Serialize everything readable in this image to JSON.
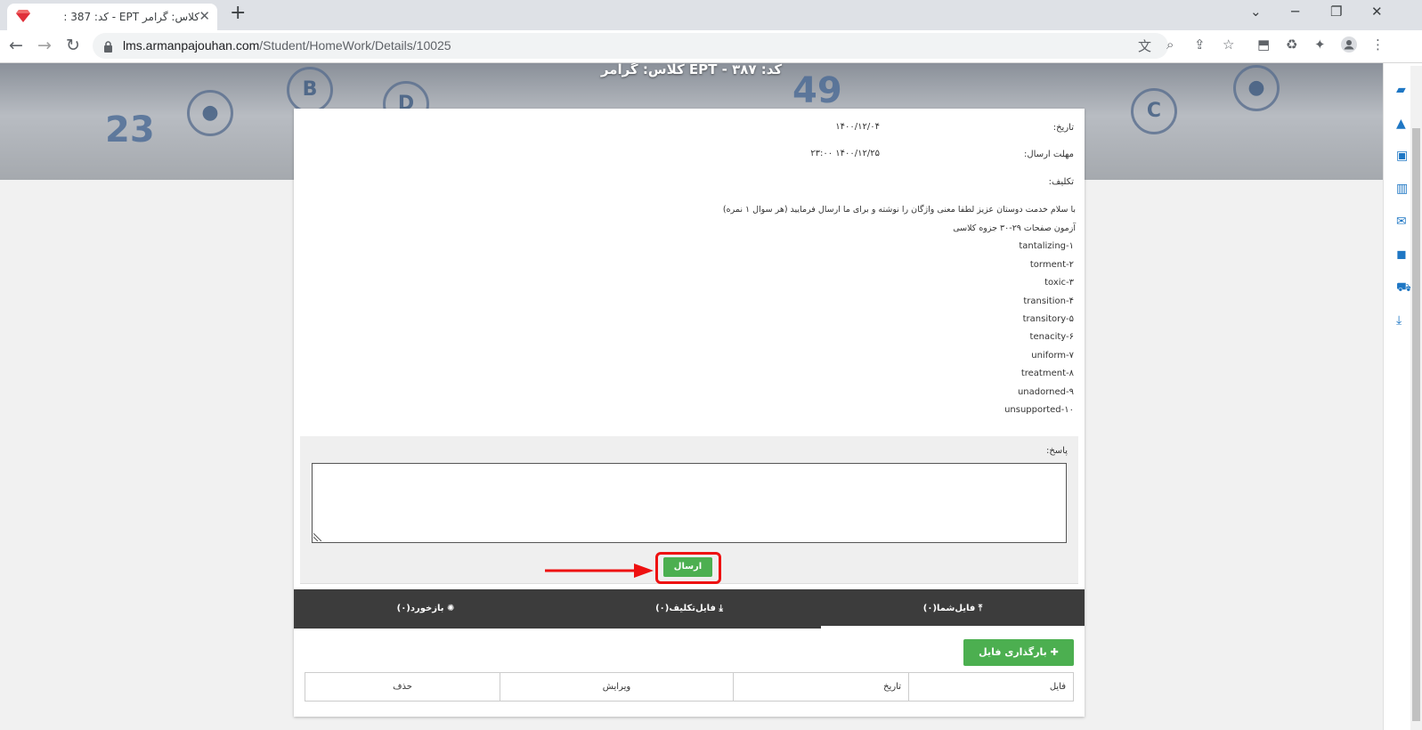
{
  "browser": {
    "tab_title": "کلاس: گرامر EPT - کد: 387 :",
    "url_host": "lms.armanpajouhan.com",
    "url_path": "/Student/HomeWork/Details/10025"
  },
  "page": {
    "hero_title": "کلاس: گرامر EPT - کد: ۳۸۷",
    "date_label": "تاریخ:",
    "date_value": "۱۴۰۰/۱۲/۰۴",
    "deadline_label": "مهلت ارسال:",
    "deadline_value": "۱۴۰۰/۱۲/۲۵ ۲۳:۰۰",
    "assignment_label": "تکلیف:",
    "line1": "با سلام خدمت دوستان عزیز لطفا معنی واژگان را نوشته و برای ما ارسال فرمایید (هر سوال ۱ نمره)",
    "line2": "آزمون صفحات ۲۹-۳۰ جزوه کلاسی",
    "vocab": [
      "tantalizing-۱",
      "torment-۲",
      "toxic-۳",
      "transition-۴",
      "transitory-۵",
      "tenacity-۶",
      "uniform-۷",
      "treatment-۸",
      "unadorned-۹",
      "unsupported-۱۰"
    ],
    "answer_label": "پاسخ:",
    "send_label": "ارسال",
    "tabs": [
      {
        "label": "فایل‌شما(۰)"
      },
      {
        "label": "فایل‌تکلیف(۰)"
      },
      {
        "label": "بازخورد(۰)"
      }
    ],
    "upload_label": "بارگذاری فایل",
    "table_headers": [
      "فایل",
      "تاریخ",
      "ویرایش",
      "حذف"
    ]
  },
  "colors": {
    "accent": "#4caf50",
    "tabs_bg": "#3c3c3c",
    "highlight": "#ee1111",
    "sidebar_icons": "#1f77c4"
  }
}
